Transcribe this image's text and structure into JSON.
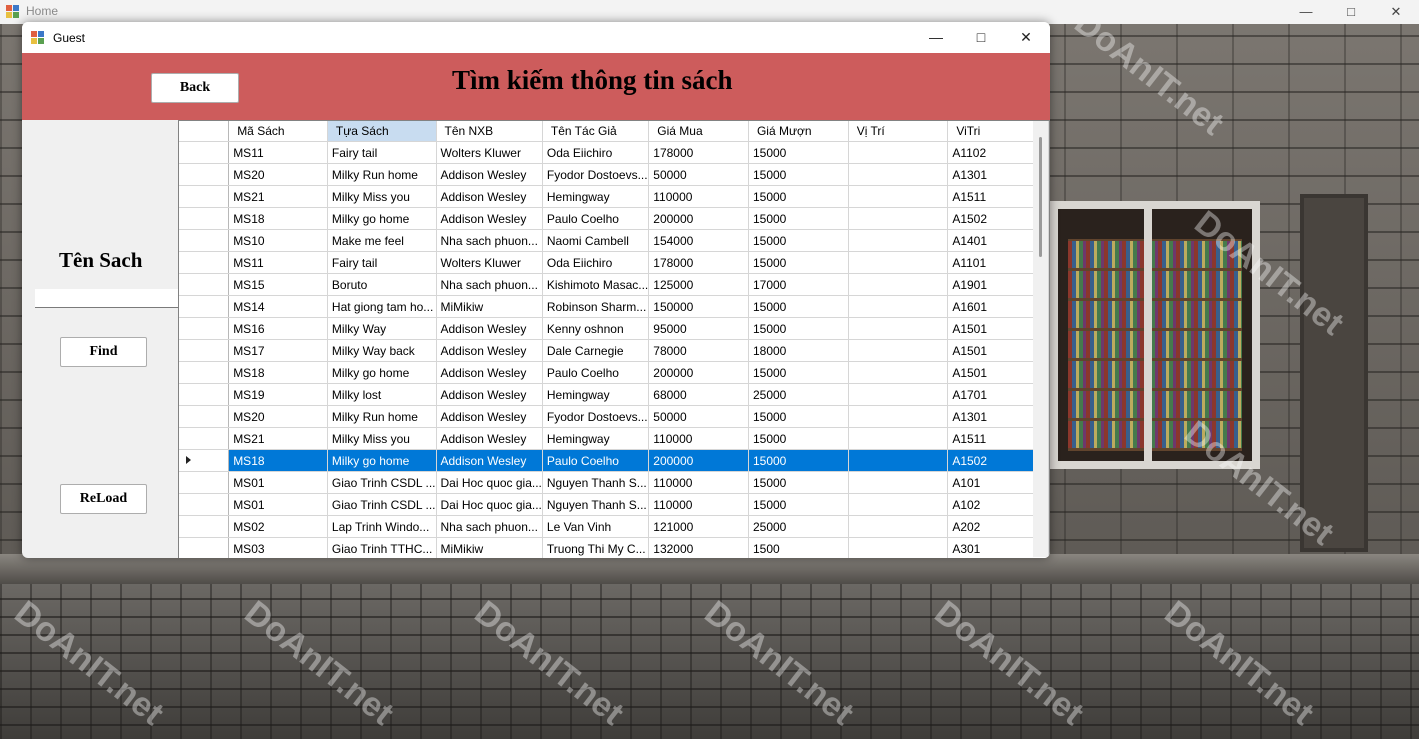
{
  "home_window": {
    "title": "Home"
  },
  "guest_window": {
    "title": "Guest"
  },
  "header": {
    "back_label": "Back",
    "page_title": "Tìm kiếm thông tin sách"
  },
  "sidebar": {
    "label": "Tên Sach",
    "search_value": "",
    "find_label": "Find",
    "reload_label": "ReLoad"
  },
  "grid": {
    "columns": [
      "Mã Sách",
      "Tựa Sách",
      "Tên NXB",
      "Tên Tác Giả",
      "Giá Mua",
      "Giá Mượn",
      "Vị Trí",
      "ViTri"
    ],
    "sorted_column": "Tựa Sách",
    "selected_row_index": 14,
    "rows": [
      [
        "MS11",
        "Fairy tail",
        "Wolters Kluwer",
        "Oda Eiichiro",
        "178000",
        "15000",
        "",
        "A1102"
      ],
      [
        "MS20",
        "Milky Run home",
        "Addison Wesley",
        "Fyodor Dostoevs...",
        "50000",
        "15000",
        "",
        "A1301"
      ],
      [
        "MS21",
        "Milky Miss you",
        "Addison Wesley",
        "Hemingway",
        "110000",
        "15000",
        "",
        "A1511"
      ],
      [
        "MS18",
        "Milky go home",
        "Addison Wesley",
        "Paulo Coelho",
        "200000",
        "15000",
        "",
        "A1502"
      ],
      [
        "MS10",
        "Make me feel",
        "Nha sach phuon...",
        "Naomi Cambell",
        "154000",
        "15000",
        "",
        "A1401"
      ],
      [
        "MS11",
        "Fairy tail",
        "Wolters Kluwer",
        "Oda Eiichiro",
        "178000",
        "15000",
        "",
        "A1101"
      ],
      [
        "MS15",
        "Boruto",
        "Nha sach phuon...",
        "Kishimoto Masac...",
        "125000",
        "17000",
        "",
        "A1901"
      ],
      [
        "MS14",
        "Hat giong tam ho...",
        "MiMikiw",
        "Robinson Sharm...",
        "150000",
        "15000",
        "",
        "A1601"
      ],
      [
        "MS16",
        "Milky Way",
        "Addison Wesley",
        "Kenny oshnon",
        "95000",
        "15000",
        "",
        "A1501"
      ],
      [
        "MS17",
        "Milky Way back",
        "Addison Wesley",
        "Dale Carnegie",
        "78000",
        "18000",
        "",
        "A1501"
      ],
      [
        "MS18",
        "Milky go home",
        "Addison Wesley",
        "Paulo Coelho",
        "200000",
        "15000",
        "",
        "A1501"
      ],
      [
        "MS19",
        "Milky lost",
        "Addison Wesley",
        "Hemingway",
        "68000",
        "25000",
        "",
        "A1701"
      ],
      [
        "MS20",
        "Milky Run home",
        "Addison Wesley",
        "Fyodor Dostoevs...",
        "50000",
        "15000",
        "",
        "A1301"
      ],
      [
        "MS21",
        "Milky Miss you",
        "Addison Wesley",
        "Hemingway",
        "110000",
        "15000",
        "",
        "A1511"
      ],
      [
        "MS18",
        "Milky go home",
        "Addison Wesley",
        "Paulo Coelho",
        "200000",
        "15000",
        "",
        "A1502"
      ],
      [
        "MS01",
        "Giao Trinh CSDL ...",
        "Dai Hoc quoc gia...",
        "Nguyen Thanh S...",
        "110000",
        "15000",
        "",
        "A101"
      ],
      [
        "MS01",
        "Giao Trinh CSDL ...",
        "Dai Hoc quoc gia...",
        "Nguyen Thanh S...",
        "110000",
        "15000",
        "",
        "A102"
      ],
      [
        "MS02",
        "Lap Trinh Windo...",
        "Nha sach phuon...",
        "Le Van Vinh",
        "121000",
        "25000",
        "",
        "A202"
      ],
      [
        "MS03",
        "Giao Trinh TTHC...",
        "MiMikiw",
        "Truong Thi My C...",
        "132000",
        "1500",
        "",
        "A301"
      ]
    ]
  },
  "watermark": {
    "text": "DoAnIT.net"
  },
  "colors": {
    "header": "#cd5c5c",
    "selection": "#0078d7"
  }
}
